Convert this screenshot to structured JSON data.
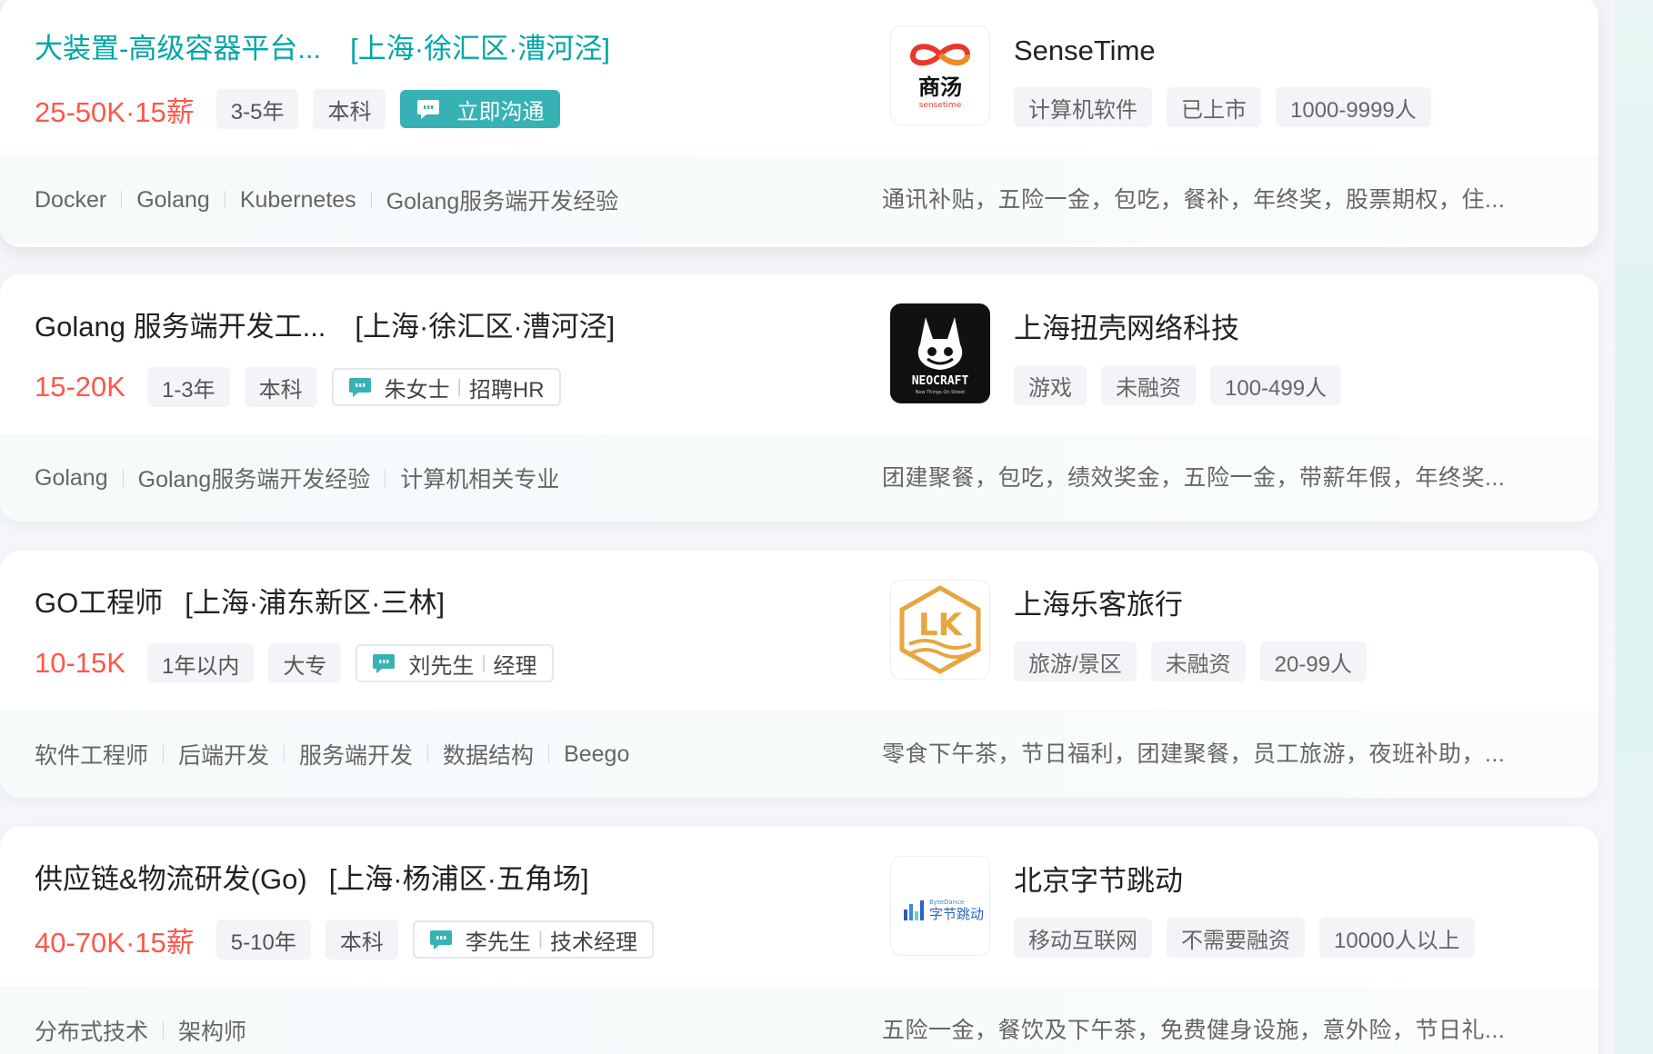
{
  "jobs": [
    {
      "title": "大装置-高级容器平台...",
      "location": "[上海·徐汇区·漕河泾]",
      "salary": "25-50K·15薪",
      "tags": [
        "3-5年",
        "本科"
      ],
      "chat_label": "立即沟通",
      "skills": [
        "Docker",
        "Golang",
        "Kubernetes",
        "Golang服务端开发经验"
      ],
      "welfare": "通讯补贴，五险一金，包吃，餐补，年终奖，股票期权，住...",
      "company": {
        "name": "SenseTime",
        "tags": [
          "计算机软件",
          "已上市",
          "1000-9999人"
        ],
        "logo_text": "商汤",
        "logo_sub": "sensetime"
      }
    },
    {
      "title": "Golang 服务端开发工...",
      "location": "[上海·徐汇区·漕河泾]",
      "salary": "15-20K",
      "tags": [
        "1-3年",
        "本科"
      ],
      "hr": {
        "name": "朱女士",
        "role": "招聘HR"
      },
      "skills": [
        "Golang",
        "Golang服务端开发经验",
        "计算机相关专业"
      ],
      "welfare": "团建聚餐，包吃，绩效奖金，五险一金，带薪年假，年终奖...",
      "company": {
        "name": "上海扭壳网络科技",
        "tags": [
          "游戏",
          "未融资",
          "100-499人"
        ],
        "logo_text": "NEOCRAFT",
        "logo_sub": "New Things On Street"
      }
    },
    {
      "title": "GO工程师",
      "location": "[上海·浦东新区·三林]",
      "salary": "10-15K",
      "tags": [
        "1年以内",
        "大专"
      ],
      "hr": {
        "name": "刘先生",
        "role": "经理"
      },
      "skills": [
        "软件工程师",
        "后端开发",
        "服务端开发",
        "数据结构",
        "Beego"
      ],
      "welfare": "零食下午茶，节日福利，团建聚餐，员工旅游，夜班补助，...",
      "company": {
        "name": "上海乐客旅行",
        "tags": [
          "旅游/景区",
          "未融资",
          "20-99人"
        ],
        "logo_text": "LK"
      }
    },
    {
      "title": "供应链&物流研发(Go)",
      "location": "[上海·杨浦区·五角场]",
      "salary": "40-70K·15薪",
      "tags": [
        "5-10年",
        "本科"
      ],
      "hr": {
        "name": "李先生",
        "role": "技术经理"
      },
      "skills": [
        "分布式技术",
        "架构师"
      ],
      "welfare": "五险一金，餐饮及下午茶，免费健身设施，意外险，节日礼...",
      "company": {
        "name": "北京字节跳动",
        "tags": [
          "移动互联网",
          "不需要融资",
          "10000人以上"
        ],
        "logo_text": "字节跳动",
        "logo_sub": "ByteDance"
      }
    }
  ],
  "colors": {
    "accent": "#00a6a7",
    "salary": "#fe574a",
    "chat_button": "#36b2b4"
  }
}
